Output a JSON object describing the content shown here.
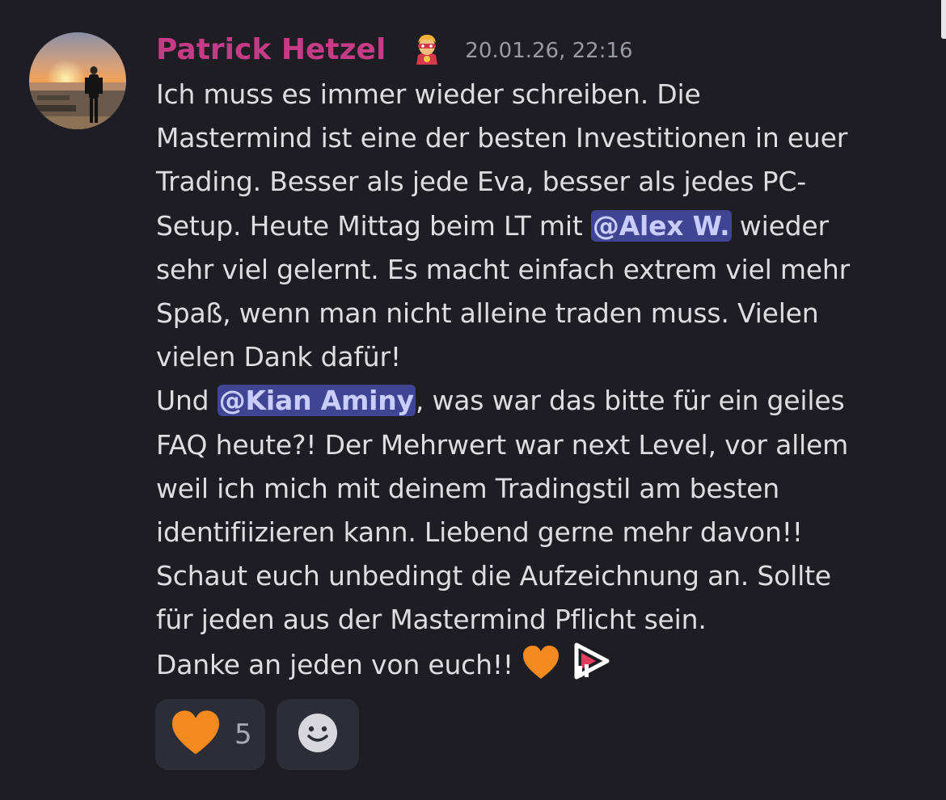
{
  "message": {
    "author": "Patrick Hetzel",
    "timestamp": "20.01.26, 22:16",
    "role_icon": "superhero-emoji-icon",
    "lines": {
      "l1": "Ich muss es immer wieder schreiben. Die",
      "l2": "Mastermind ist eine der besten Investitionen in euer",
      "l3": "Trading. Besser als jede Eva, besser als jedes PC-",
      "l4_before": "Setup. Heute Mittag beim LT mit ",
      "l4_mention": "@Alex W.",
      "l4_after": " wieder",
      "l5": "sehr viel gelernt. Es macht einfach extrem viel mehr",
      "l6": "Spaß, wenn man nicht alleine traden muss. Vielen",
      "l7": "vielen Dank dafür!",
      "l8_before": "Und ",
      "l8_mention": "@Kian Aminy",
      "l8_after": ", was war das bitte für ein geiles",
      "l9": "FAQ heute?! Der Mehrwert war next Level, vor allem",
      "l10": "weil ich mich mit deinem Tradingstil am besten",
      "l11": "identifiizieren kann. Liebend gerne mehr davon!!",
      "l12": "Schaut euch unbedingt die Aufzeichnung an. Sollte",
      "l13": "für jeden aus der Mastermind Pflicht sein.",
      "l14": "Danke an jeden von euch!! "
    },
    "inline_emojis": [
      "orange-heart-icon",
      "custom-logo-icon"
    ]
  },
  "reactions": [
    {
      "icon": "orange-heart-icon",
      "count": "5"
    },
    {
      "icon": "add-reaction-smiley-icon"
    }
  ],
  "colors": {
    "background": "#1d1d23",
    "username": "#c63b86",
    "mention_bg": "#3f4593",
    "text": "#dddde2",
    "reaction_bg": "#2c2d36"
  }
}
